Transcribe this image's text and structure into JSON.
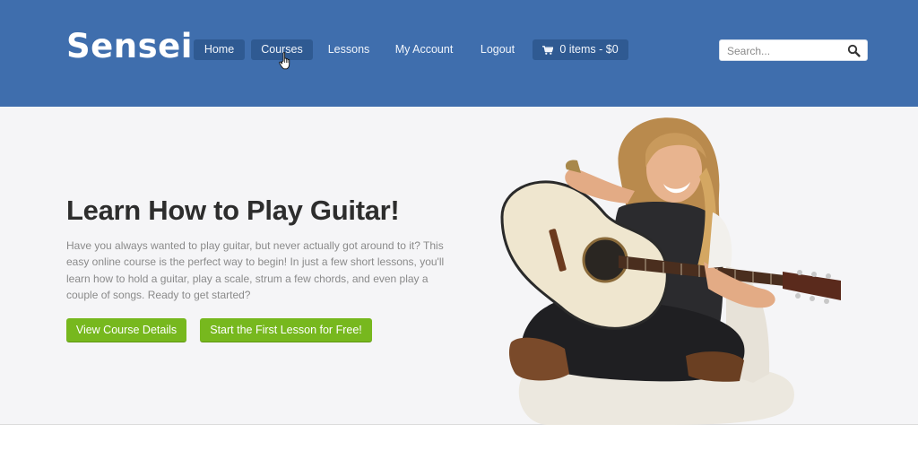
{
  "brand": {
    "logo": "Sensei"
  },
  "nav": {
    "items": [
      {
        "label": "Home",
        "active": true
      },
      {
        "label": "Courses",
        "hovered": true
      },
      {
        "label": "Lessons"
      },
      {
        "label": "My Account"
      },
      {
        "label": "Logout"
      }
    ],
    "cart": {
      "label": "0 items - $0",
      "icon": "cart-icon"
    }
  },
  "search": {
    "placeholder": "Search...",
    "icon": "search-icon"
  },
  "hero": {
    "title": "Learn How to Play Guitar!",
    "text": "Have you always wanted to play guitar, but never actually got around to it?  This easy online course is the perfect way to begin! In just a few short lessons, you'll learn how to hold a guitar, play a scale, strum a few chords, and even play a couple of songs.  Ready to get started?",
    "buttons": {
      "details": "View Course Details",
      "lesson": "Start the First Lesson for Free!"
    }
  },
  "colors": {
    "header": "#3f6ead",
    "nav_pill": "#2f5a92",
    "button_green": "#77b81e",
    "hero_bg": "#f5f5f7"
  }
}
